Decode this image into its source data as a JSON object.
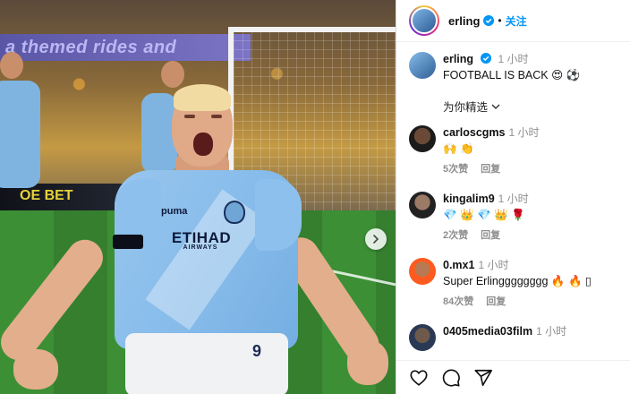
{
  "media": {
    "banner_text": "a themed rides and",
    "ad_text": "OE BET"
  },
  "jersey": {
    "sponsor": "ETIHAD",
    "sponsor_sub": "AIRWAYS",
    "brand": "puma",
    "shorts_number": "9"
  },
  "header": {
    "username": "erling",
    "dot": "•",
    "follow_label": "关注"
  },
  "caption": {
    "username": "erling",
    "time": "1 小时",
    "text": "FOOTBALL IS BACK 😍 ⚽"
  },
  "picked_label": "为你精选",
  "comments": [
    {
      "user": "carloscgms",
      "time": "1 小时",
      "text": "🙌 👏",
      "likes": "5次赞",
      "reply": "回复"
    },
    {
      "user": "kingalim9",
      "time": "1 小时",
      "text": "💎 👑 💎 👑 🌹",
      "likes": "2次赞",
      "reply": "回复"
    },
    {
      "user": "0.mx1",
      "time": "1 小时",
      "text": "Super Erlingggggggg 🔥 🔥 ▯",
      "likes": "84次赞",
      "reply": "回复"
    },
    {
      "user": "0405media03film",
      "time": "1 小时",
      "text": "",
      "likes": "",
      "reply": ""
    }
  ],
  "icons": {
    "like": "heart-icon",
    "comment": "comment-icon",
    "share": "share-icon",
    "next": "chevron-right-icon",
    "verified": "verified-badge-icon"
  },
  "colors": {
    "follow_blue": "#0095f6",
    "verified_blue": "#0095f6",
    "muted": "#8e8e8e"
  }
}
